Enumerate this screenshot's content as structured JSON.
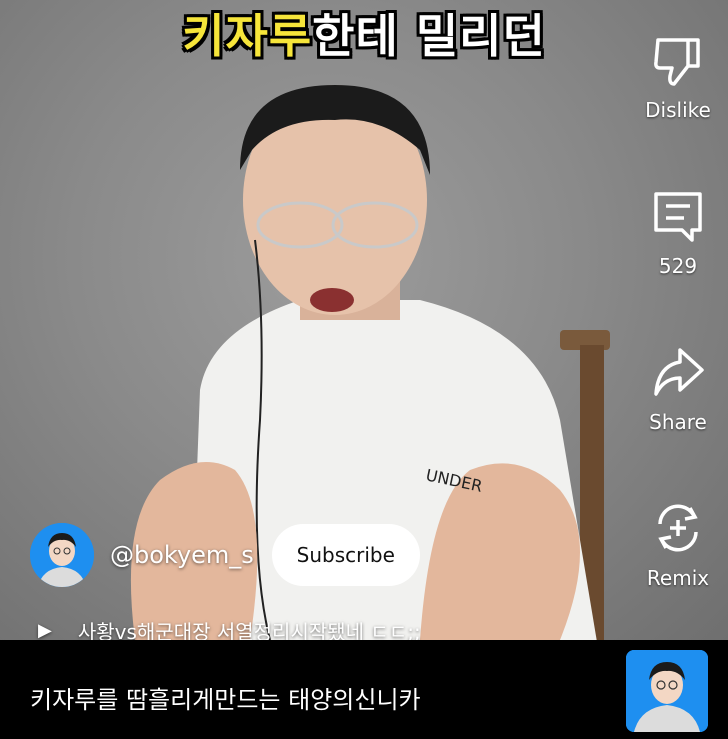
{
  "caption": {
    "highlight": "키자루",
    "rest": "한테 밀리던"
  },
  "actions": {
    "dislike_label": "Dislike",
    "comments_count": "529",
    "share_label": "Share",
    "remix_label": "Remix"
  },
  "channel": {
    "handle": "@bokyem_s",
    "subscribe_label": "Subscribe"
  },
  "music": {
    "text": "사황vs해군대장 서열정리시작됐네 ㄷㄷ;;"
  },
  "bottom": {
    "title": "키자루를 땀흘리게만드는 태양의신니카"
  },
  "colors": {
    "caption_highlight": "#f6e53a",
    "avatar_bg": "#1e8ff0"
  }
}
